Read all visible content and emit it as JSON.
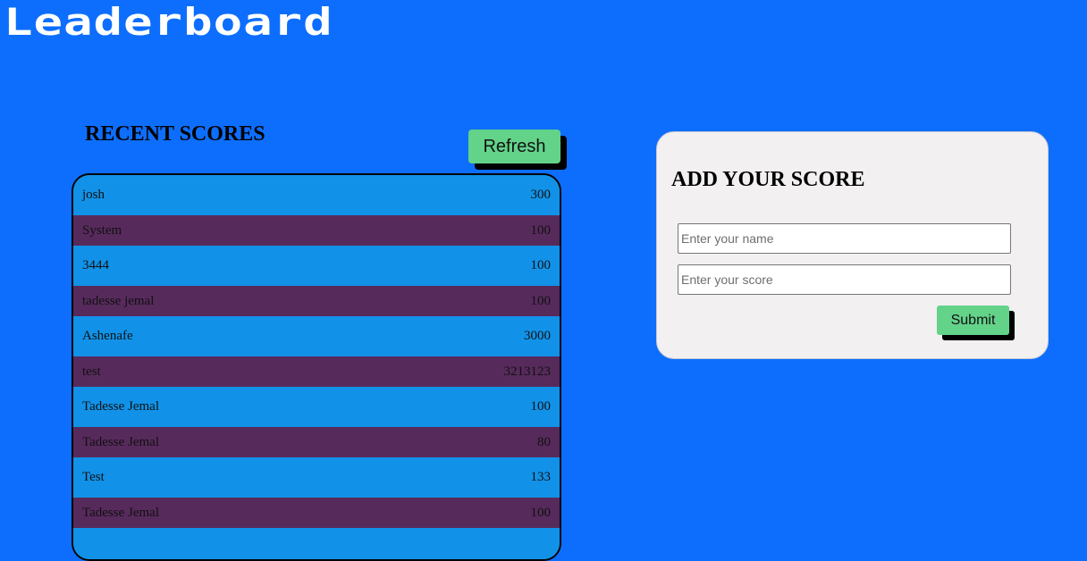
{
  "app": {
    "title": "Leaderboard",
    "colors": {
      "background": "#0d6efd",
      "row_primary": "#1192e8",
      "row_alternate": "#572a5c",
      "button": "#63d38a",
      "card": "#f2f0f1"
    }
  },
  "recent": {
    "heading": "RECENT SCORES",
    "refresh_label": "Refresh",
    "scores": [
      {
        "name": "josh",
        "score": "300"
      },
      {
        "name": "System",
        "score": "100"
      },
      {
        "name": "3444",
        "score": "100"
      },
      {
        "name": "tadesse jemal",
        "score": "100"
      },
      {
        "name": "Ashenafe",
        "score": "3000"
      },
      {
        "name": "test",
        "score": "3213123"
      },
      {
        "name": "Tadesse Jemal",
        "score": "100"
      },
      {
        "name": "Tadesse Jemal",
        "score": "80"
      },
      {
        "name": "Test",
        "score": "133"
      },
      {
        "name": "Tadesse Jemal",
        "score": "100"
      }
    ]
  },
  "add_score": {
    "heading": "ADD YOUR SCORE",
    "name_placeholder": "Enter your name",
    "score_placeholder": "Enter your score",
    "name_value": "",
    "score_value": "",
    "submit_label": "Submit"
  }
}
